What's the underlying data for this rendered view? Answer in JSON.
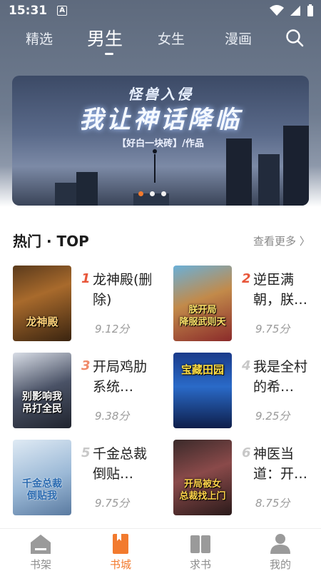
{
  "status_bar": {
    "time": "15:31",
    "a_badge": "A"
  },
  "top_nav": {
    "tabs": [
      {
        "label": "精选"
      },
      {
        "label": "男生"
      },
      {
        "label": "女生"
      },
      {
        "label": "漫画"
      }
    ],
    "active_tab": "男生"
  },
  "banner": {
    "subtitle": "怪兽入侵",
    "title": "我让神话降临",
    "author_line": "【好白一块砖】/作品",
    "page_count": 3,
    "active_page": 1
  },
  "section": {
    "title": "热门 · TOP",
    "more_label": "查看更多 〉"
  },
  "books": [
    {
      "rank": "1",
      "name": "龙神殿(删除)",
      "score": "9.12分",
      "cover_text": "龙神殿",
      "rank_color": "#e8563a"
    },
    {
      "rank": "2",
      "name": "逆臣满朝，朕…",
      "score": "9.75分",
      "cover_text": "朕开局\n降服武则天",
      "rank_color": "#e8563a"
    },
    {
      "rank": "3",
      "name": "开局鸡肋系统…",
      "score": "9.38分",
      "cover_text": "别影响我\n吊打全民",
      "rank_color": "#f08a6a"
    },
    {
      "rank": "4",
      "name": "我是全村的希…",
      "score": "9.25分",
      "cover_text": "宝藏田园",
      "rank_color": "#c8c8c8"
    },
    {
      "rank": "5",
      "name": "千金总裁倒贴…",
      "score": "9.75分",
      "cover_text": "千金总裁\n倒贴我",
      "rank_color": "#c8c8c8"
    },
    {
      "rank": "6",
      "name": "神医当道：开…",
      "score": "8.75分",
      "cover_text": "开局被女\n总裁找上门",
      "rank_color": "#c8c8c8"
    }
  ],
  "bottom_nav": [
    {
      "label": "书架",
      "icon": "bookshelf-icon"
    },
    {
      "label": "书城",
      "icon": "bookstore-icon"
    },
    {
      "label": "求书",
      "icon": "request-book-icon"
    },
    {
      "label": "我的",
      "icon": "profile-icon"
    }
  ],
  "colors": {
    "accent": "#f27a2e"
  }
}
